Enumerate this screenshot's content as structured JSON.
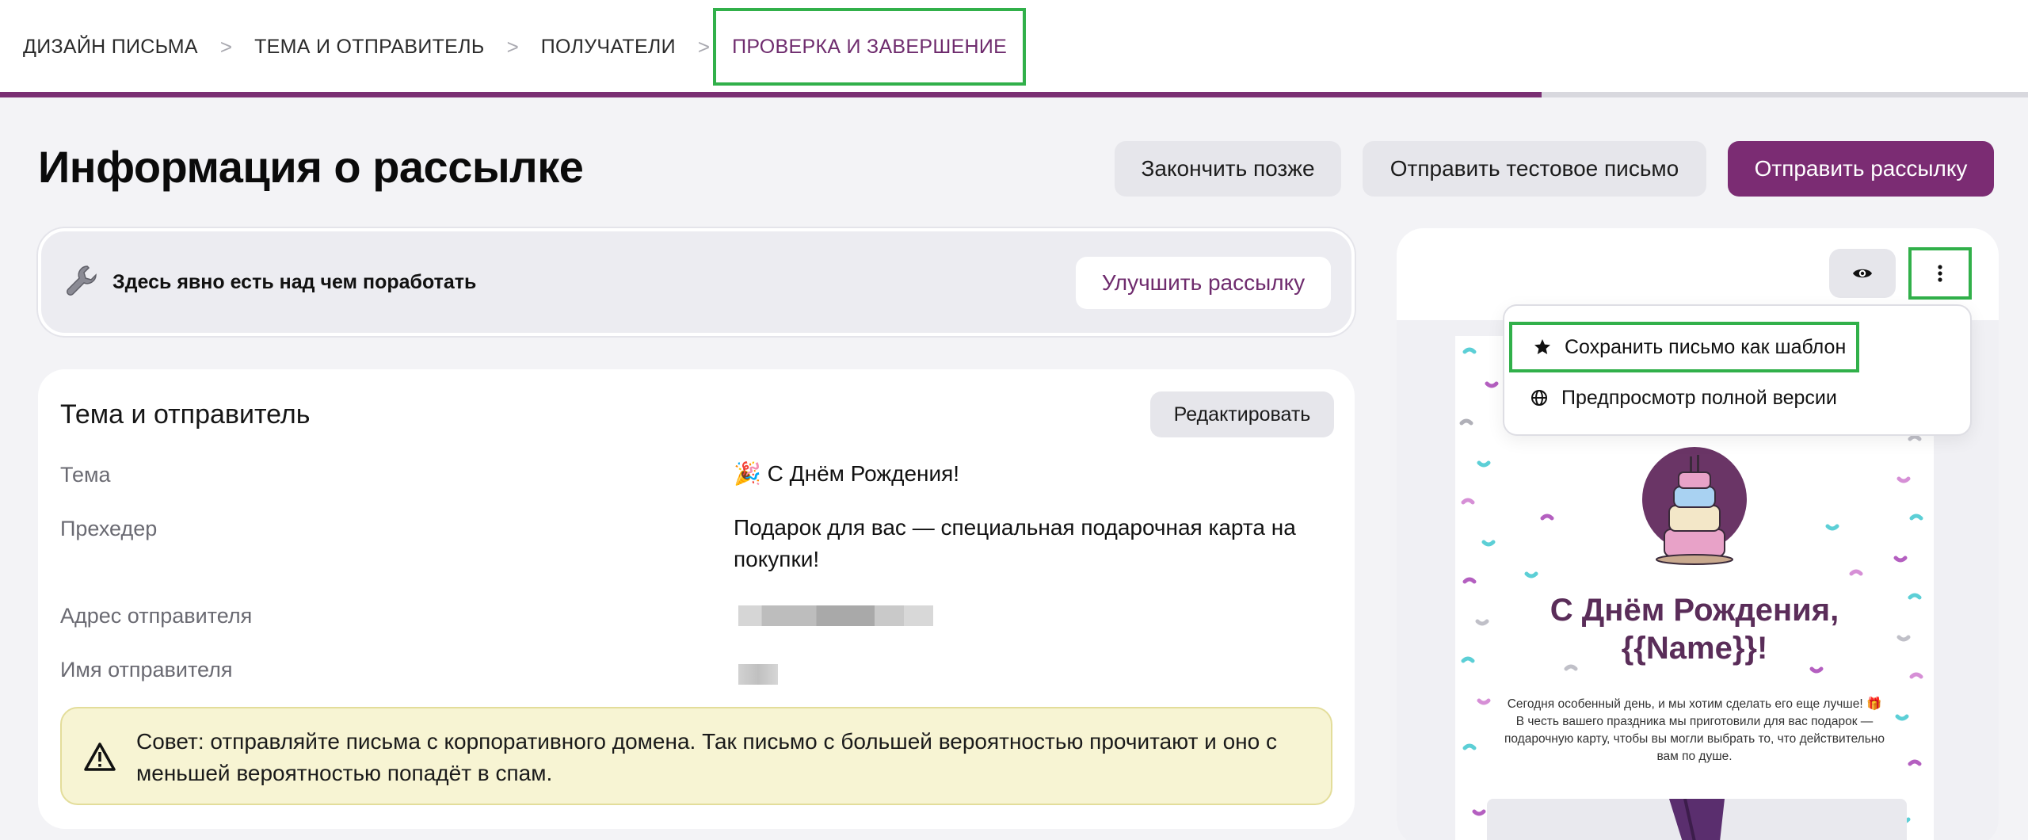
{
  "steps": [
    {
      "label": "ДИЗАЙН ПИСЬМА"
    },
    {
      "label": "ТЕМА И ОТПРАВИТЕЛЬ"
    },
    {
      "label": "ПОЛУЧАТЕЛИ"
    },
    {
      "label": "ПРОВЕРКА И ЗАВЕРШЕНИЕ"
    }
  ],
  "step_separator": ">",
  "progress_fraction": 0.76,
  "page": {
    "title": "Информация о рассылке",
    "finish_later": "Закончить позже",
    "send_test": "Отправить тестовое письмо",
    "send": "Отправить рассылку"
  },
  "improve": {
    "text": "Здесь явно есть над чем поработать",
    "button": "Улучшить рассылку",
    "icon": "wrench-icon"
  },
  "info": {
    "title": "Тема и отправитель",
    "edit": "Редактировать",
    "rows": [
      {
        "label": "Тема",
        "value": "🎉 С Днём Рождения!"
      },
      {
        "label": "Прехедер",
        "value": "Подарок для вас — специальная подарочная карта на покупки!"
      },
      {
        "label": "Адрес отправителя",
        "value": ""
      },
      {
        "label": "Имя отправителя",
        "value": ""
      }
    ],
    "tip": "Совет: отправляйте письма с корпоративного домена. Так письмо с большей вероятностью прочитают и оно с меньшей вероятностью попадёт в спам."
  },
  "preview": {
    "menu": [
      {
        "label": "Сохранить письмо как шаблон",
        "icon": "star-icon"
      },
      {
        "label": "Предпросмотр полной версии",
        "icon": "globe-icon"
      }
    ],
    "email": {
      "heading_line1": "С Днём Рождения,",
      "heading_line2": "{{Name}}!",
      "body": "Сегодня особенный день, и мы хотим сделать его еще лучше! 🎁 В честь вашего праздника мы приготовили для вас подарок — подарочную карту, чтобы вы могли выбрать то, что действительно вам по душе."
    }
  },
  "colors": {
    "brand": "#7b2c73",
    "highlight": "#31b04a",
    "tip_bg": "#f7f4d3"
  }
}
